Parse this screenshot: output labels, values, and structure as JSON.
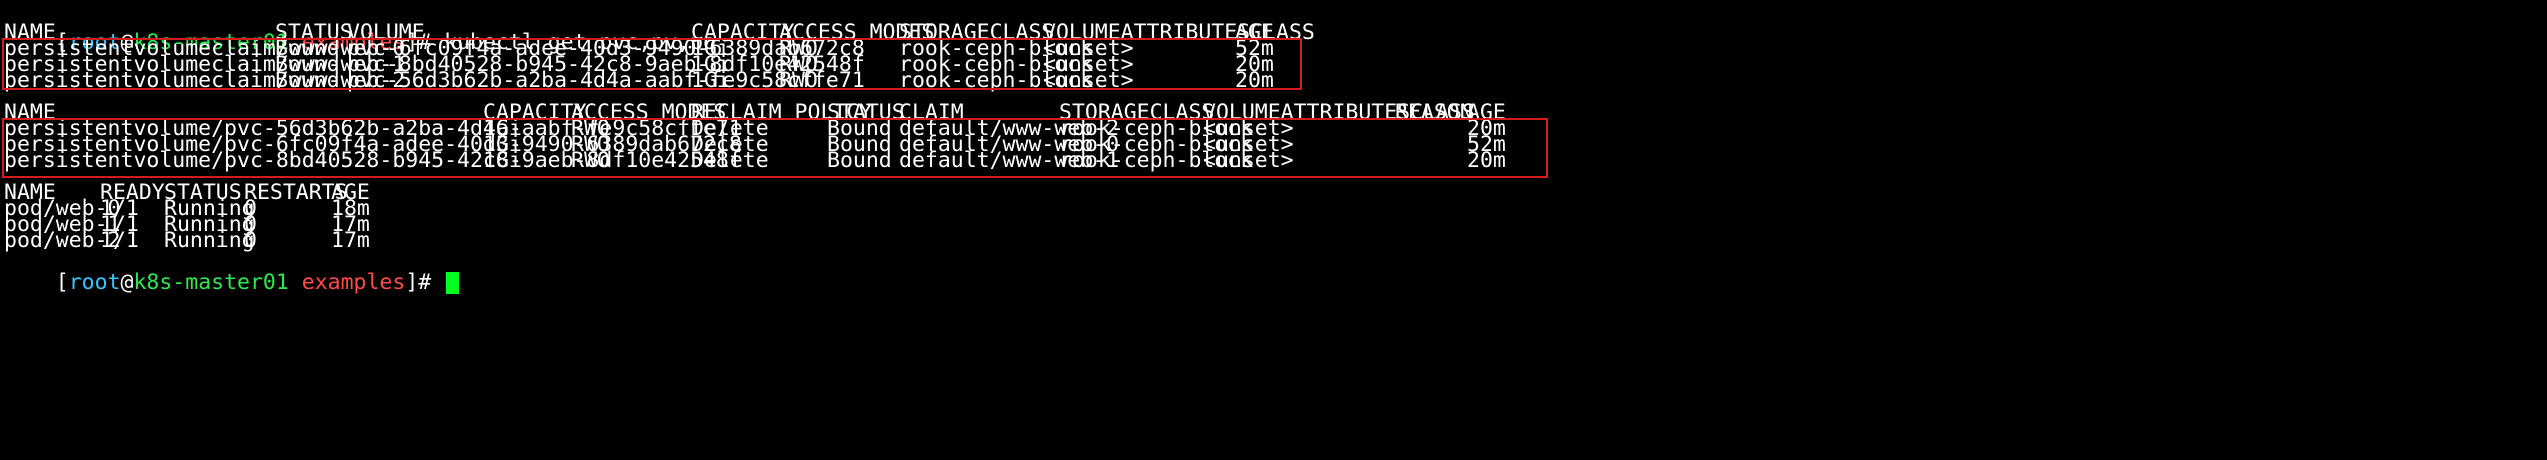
{
  "prompt_line_1": {
    "open_bracket": "[",
    "user": "root",
    "at": "@",
    "host": "k8s-master01",
    "space": " ",
    "dir": "examples",
    "close": "]# ",
    "command": "kubectl get pvc,pv,po"
  },
  "pvc_table": {
    "headers": [
      "NAME",
      "STATUS",
      "VOLUME",
      "CAPACITY",
      "ACCESS MODES",
      "STORAGECLASS",
      "VOLUMEATTRIBUTESCLASS",
      "AGE"
    ],
    "rows": [
      [
        "persistentvolumeclaim/www-web-0",
        "Bound",
        "pvc-6fc09f4a-adee-40d3-9490-6389dab672c8",
        "1Gi",
        "RWO",
        "rook-ceph-block",
        "<unset>",
        "52m"
      ],
      [
        "persistentvolumeclaim/www-web-1",
        "Bound",
        "pvc-8bd40528-b945-42c8-9aeb-8df10e42548f",
        "1Gi",
        "RWO",
        "rook-ceph-block",
        "<unset>",
        "20m"
      ],
      [
        "persistentvolumeclaim/www-web-2",
        "Bound",
        "pvc-56d3b62b-a2ba-4d4a-aabf-fe9c58cffe71",
        "1Gi",
        "RWO",
        "rook-ceph-block",
        "<unset>",
        "20m"
      ]
    ]
  },
  "pv_table": {
    "headers": [
      "NAME",
      "CAPACITY",
      "ACCESS MODES",
      "RECLAIM POLICY",
      "STATUS",
      "CLAIM",
      "STORAGECLASS",
      "VOLUMEATTRIBUTESCLASS",
      "REASON",
      "AGE"
    ],
    "rows": [
      [
        "persistentvolume/pvc-56d3b62b-a2ba-4d4a-aabf-fe9c58cffe71",
        "1Gi",
        "RWO",
        "Delete",
        "Bound",
        "default/www-web-2",
        "rook-ceph-block",
        "<unset>",
        "",
        "20m"
      ],
      [
        "persistentvolume/pvc-6fc09f4a-adee-40d3-9490-6389dab672c8",
        "1Gi",
        "RWO",
        "Delete",
        "Bound",
        "default/www-web-0",
        "rook-ceph-block",
        "<unset>",
        "",
        "52m"
      ],
      [
        "persistentvolume/pvc-8bd40528-b945-42c8-9aeb-8df10e42548f",
        "1Gi",
        "RWO",
        "Delete",
        "Bound",
        "default/www-web-1",
        "rook-ceph-block",
        "<unset>",
        "",
        "20m"
      ]
    ]
  },
  "pod_table": {
    "headers": [
      "NAME",
      "READY",
      "STATUS",
      "RESTARTS",
      "AGE"
    ],
    "rows": [
      [
        "pod/web-0",
        "1/1",
        "Running",
        "0",
        "18m"
      ],
      [
        "pod/web-1",
        "1/1",
        "Running",
        "0",
        "17m"
      ],
      [
        "pod/web-2",
        "1/1",
        "Running",
        "0",
        "17m"
      ]
    ]
  },
  "prompt_line_2": {
    "open_bracket": "[",
    "user": "root",
    "at": "@",
    "host": "k8s-master01",
    "space": " ",
    "dir": "examples",
    "close": "]# "
  },
  "colors": {
    "background": "#000000",
    "text": "#ffffff",
    "user": "#37c5ff",
    "host": "#2ee84f",
    "dir": "#ff4a4a",
    "cursor": "#00ff1e",
    "highlight_box": "#d51c1c"
  }
}
